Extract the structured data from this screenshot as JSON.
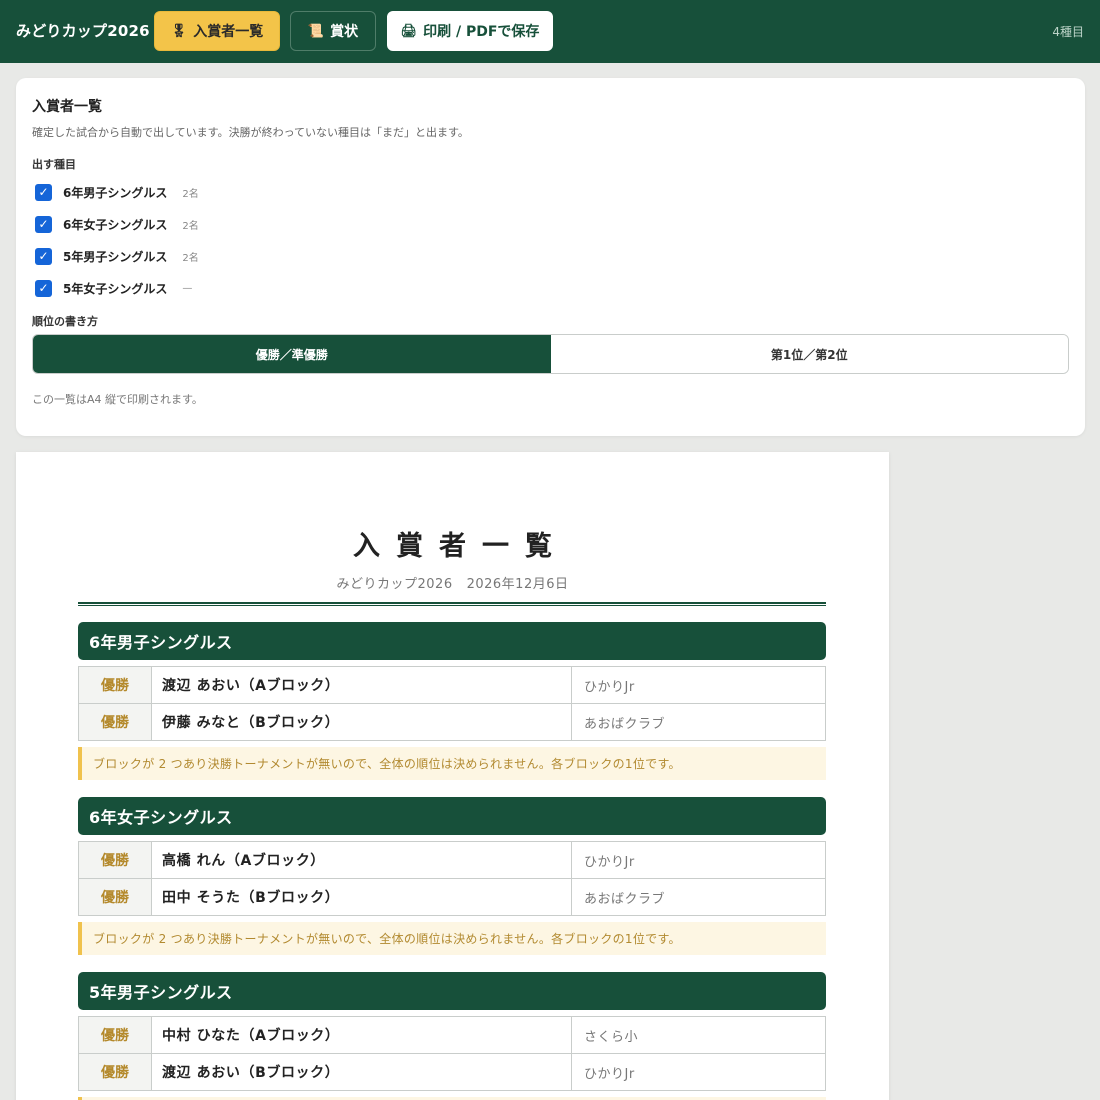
{
  "header": {
    "app_title": "みどりカップ2026",
    "buttons": {
      "winners_icon": "🎖",
      "winners_label": "入賞者一覧",
      "certificate_icon": "📜",
      "certificate_label": "賞状",
      "print_icon": "🖨",
      "print_label": "印刷 / PDFで保存"
    },
    "event_count": "4種目"
  },
  "settings": {
    "title": "入賞者一覧",
    "description": "確定した試合から自動で出しています。決勝が終わっていない種目は「まだ」と出ます。",
    "events_label": "出す種目",
    "events": [
      {
        "name": "6年男子シングルス",
        "count": "2名",
        "checked": true
      },
      {
        "name": "6年女子シングルス",
        "count": "2名",
        "checked": true
      },
      {
        "name": "5年男子シングルス",
        "count": "2名",
        "checked": true
      },
      {
        "name": "5年女子シングルス",
        "count": "—",
        "checked": true
      }
    ],
    "rank_format_label": "順位の書き方",
    "rank_options": [
      "優勝／準優勝",
      "第1位／第2位"
    ],
    "rank_selected": "優勝／準優勝",
    "note": "この一覧はA4 縦で印刷されます。"
  },
  "document": {
    "title": "入賞者一覧",
    "tournament": "みどりカップ2026",
    "date": "2026年12月6日",
    "sections": [
      {
        "event": "6年男子シングルス",
        "rows": [
          {
            "rank": "優勝",
            "name": "渡辺 あおい（Aブロック）",
            "club": "ひかりJr"
          },
          {
            "rank": "優勝",
            "name": "伊藤 みなと（Bブロック）",
            "club": "あおばクラブ"
          }
        ],
        "note": "ブロックが 2 つあり決勝トーナメントが無いので、全体の順位は決められません。各ブロックの1位です。"
      },
      {
        "event": "6年女子シングルス",
        "rows": [
          {
            "rank": "優勝",
            "name": "高橋 れん（Aブロック）",
            "club": "ひかりJr"
          },
          {
            "rank": "優勝",
            "name": "田中 そうた（Bブロック）",
            "club": "あおばクラブ"
          }
        ],
        "note": "ブロックが 2 つあり決勝トーナメントが無いので、全体の順位は決められません。各ブロックの1位です。"
      },
      {
        "event": "5年男子シングルス",
        "rows": [
          {
            "rank": "優勝",
            "name": "中村 ひなた（Aブロック）",
            "club": "さくら小"
          },
          {
            "rank": "優勝",
            "name": "渡辺 あおい（Bブロック）",
            "club": "ひかりJr"
          }
        ],
        "note": ""
      }
    ]
  },
  "colors": {
    "primary": "#17503a",
    "accent": "#f3c449",
    "checkbox": "#1565d8",
    "rank_text": "#b4892b",
    "note_bg": "#fdf6e3"
  }
}
